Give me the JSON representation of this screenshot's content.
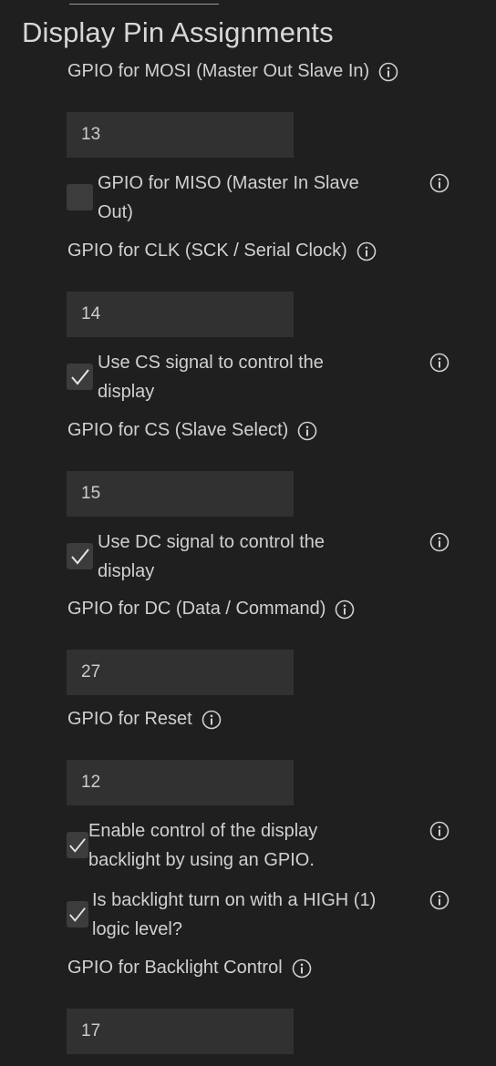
{
  "section": {
    "title": "Display Pin Assignments"
  },
  "fields": {
    "mosi": {
      "label": "GPIO for MOSI (Master Out Slave In)",
      "value": "13"
    },
    "miso": {
      "line1": "GPIO for MISO (Master In Slave",
      "line2": "Out)",
      "checked": false
    },
    "clk": {
      "label": "GPIO for CLK (SCK / Serial Clock)",
      "value": "14"
    },
    "use_cs": {
      "line1": "Use CS signal to control the",
      "line2": "display",
      "checked": true
    },
    "cs": {
      "label": "GPIO for CS (Slave Select)",
      "value": "15"
    },
    "use_dc": {
      "line1": "Use DC signal to control the",
      "line2": "display",
      "checked": true
    },
    "dc": {
      "label": "GPIO for DC (Data / Command)",
      "value": "27"
    },
    "reset": {
      "label": "GPIO for Reset",
      "value": "12"
    },
    "backlight_enable": {
      "line1": "Enable control of the display",
      "line2": "backlight by using an GPIO.",
      "checked": true
    },
    "backlight_high": {
      "line1": "Is backlight turn on with a HIGH (1)",
      "line2": "logic level?",
      "checked": true
    },
    "backlight": {
      "label": "GPIO for Backlight Control",
      "value": "17"
    }
  },
  "icons": {
    "info": "info-icon",
    "check": "checkmark-icon"
  },
  "colors": {
    "background": "#1f1f1f",
    "input_background": "#313131",
    "checkbox_background": "#3c3c3c",
    "text": "#d0d0d0"
  }
}
